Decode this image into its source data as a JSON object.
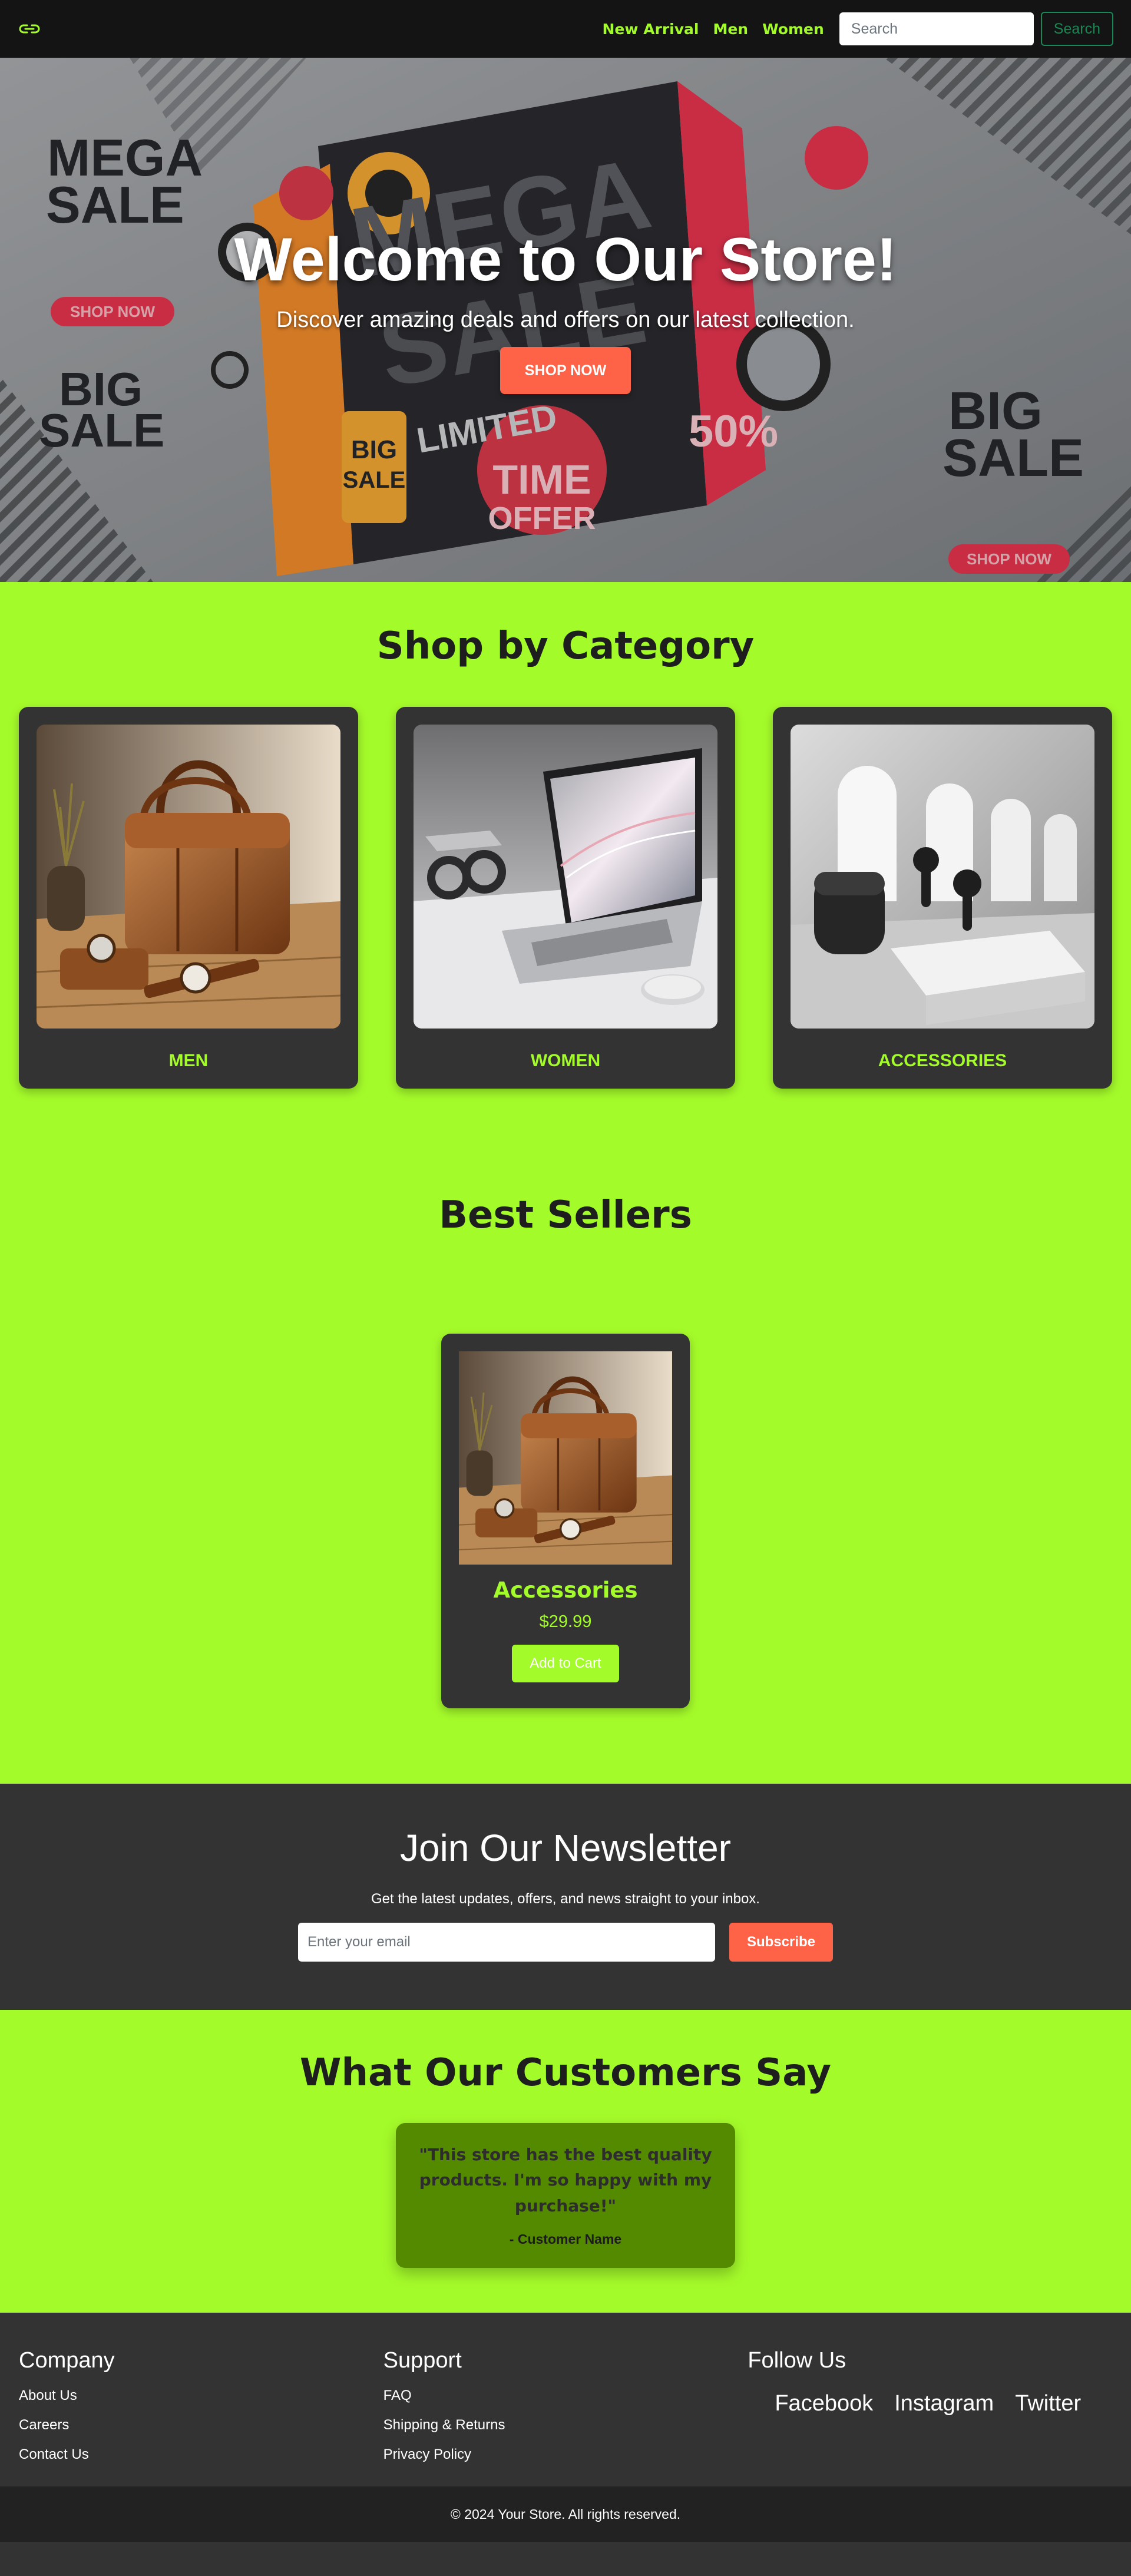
{
  "nav": {
    "links": [
      "New Arrival",
      "Men",
      "Women"
    ],
    "search_placeholder": "Search",
    "search_button": "Search"
  },
  "hero": {
    "title": "Welcome to Our Store!",
    "subtitle": "Discover amazing deals and offers on our latest collection.",
    "button": "SHOP NOW",
    "art_text": {
      "mega": "MEGA",
      "sale": "SALE",
      "big": "BIG",
      "shop_now": "SHOP NOW",
      "limited": "LIMITED",
      "time": "TIME",
      "offer": "OFFER",
      "percent": "50%"
    }
  },
  "categories": {
    "title": "Shop by Category",
    "items": [
      {
        "label": "MEN",
        "image": "handbag-photo"
      },
      {
        "label": "WOMEN",
        "image": "laptop-photo"
      },
      {
        "label": "ACCESSORIES",
        "image": "earbuds-photo"
      }
    ]
  },
  "bestsellers": {
    "title": "Best Sellers",
    "product": {
      "name": "Accessories",
      "price": "$29.99",
      "button": "Add to Cart",
      "image": "handbag-photo"
    }
  },
  "newsletter": {
    "title": "Join Our Newsletter",
    "text": "Get the latest updates, offers, and news straight to your inbox.",
    "placeholder": "Enter your email",
    "button": "Subscribe"
  },
  "testimonials": {
    "title": "What Our Customers Say",
    "quote": "\"This store has the best quality products. I'm so happy with my purchase!\"",
    "author": "- Customer Name"
  },
  "footer": {
    "company": {
      "title": "Company",
      "links": [
        "About Us",
        "Careers",
        "Contact Us"
      ]
    },
    "support": {
      "title": "Support",
      "links": [
        "FAQ",
        "Shipping & Returns",
        "Privacy Policy"
      ]
    },
    "follow": {
      "title": "Follow Us",
      "links": [
        "Facebook",
        "Instagram",
        "Twitter"
      ]
    },
    "copyright": "© 2024 Your Store. All rights reserved."
  },
  "colors": {
    "accent_green": "#a4fb2a",
    "dark": "#333333",
    "navbar": "#141414",
    "tomato": "#ff6347",
    "testimonial_card": "#548a00",
    "search_outline": "#198754"
  }
}
